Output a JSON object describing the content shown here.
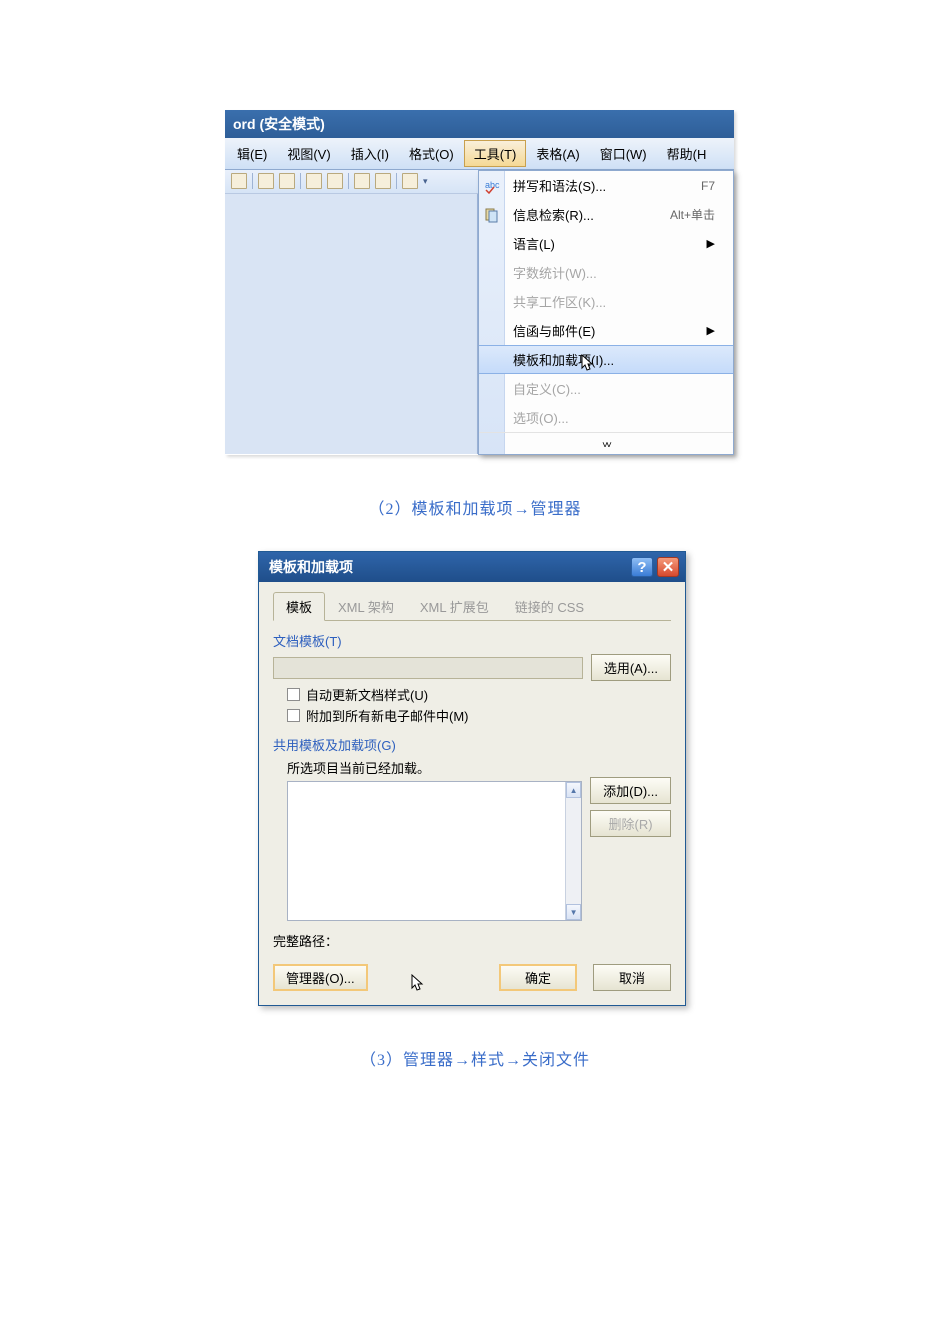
{
  "shot1": {
    "title_fragment": "ord (安全模式)",
    "menus": {
      "edit": "辑(E)",
      "view": "视图(V)",
      "insert": "插入(I)",
      "format": "格式(O)",
      "tools": "工具(T)",
      "table": "表格(A)",
      "window": "窗口(W)",
      "help": "帮助(H"
    },
    "dropdown": {
      "spelling": "拼写和语法(S)...",
      "spelling_shortcut": "F7",
      "research": "信息检索(R)...",
      "research_shortcut": "Alt+单击",
      "language": "语言(L)",
      "wordcount": "字数统计(W)...",
      "shared": "共享工作区(K)...",
      "letters": "信函与邮件(E)",
      "templates": "模板和加载项(I)...",
      "customize": "自定义(C)...",
      "options": "选项(O)..."
    }
  },
  "caption1": "（2）模板和加载项→管理器",
  "dialog": {
    "title": "模板和加载项",
    "tabs": {
      "templates": "模板",
      "xml_schema": "XML 架构",
      "xml_exp": "XML 扩展包",
      "linked_css": "链接的 CSS"
    },
    "doc_template_label": "文档模板(T)",
    "select_btn": "选用(A)...",
    "auto_update": "自动更新文档样式(U)",
    "attach_email": "附加到所有新电子邮件中(M)",
    "global_label": "共用模板及加载项(G)",
    "loaded_text": "所选项目当前已经加载。",
    "add_btn": "添加(D)...",
    "remove_btn": "删除(R)",
    "full_path": "完整路径：",
    "organizer_btn": "管理器(O)...",
    "ok_btn": "确定",
    "cancel_btn": "取消"
  },
  "caption2": "（3）管理器→样式→关闭文件"
}
